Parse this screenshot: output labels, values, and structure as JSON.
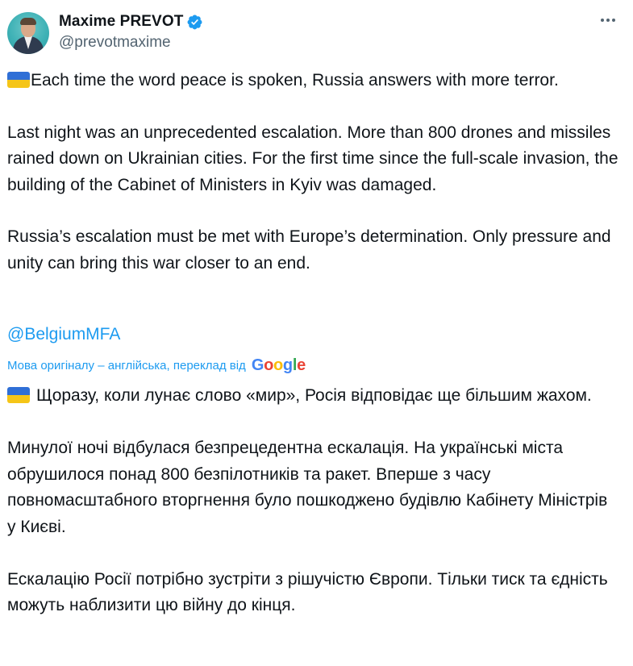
{
  "author": {
    "display_name": "Maxime PREVOT",
    "handle": "@prevotmaxime",
    "avatar_icon": "person-avatar",
    "verified_icon": "verified-badge-icon"
  },
  "menu": {
    "more_icon": "more-horizontal-icon"
  },
  "tweet": {
    "paragraphs": [
      "Each time the word peace is spoken, Russia answers with more terror.",
      "Last night was an unprecedented escalation. More than 800 drones and missiles rained down on Ukrainian cities. For the first time since the full-scale invasion, the building of the Cabinet of Ministers in Kyiv was damaged.",
      "Russia’s escalation must be met with Europe’s determination. Only pressure and unity can bring this war closer to an end."
    ],
    "mention": "@BelgiumMFA"
  },
  "translation": {
    "note": "Мова оригіналу – англійська, переклад від",
    "provider": "Google",
    "paragraphs": [
      "Щоразу, коли лунає слово «мир», Росія відповідає ще більшим жахом.",
      "Минулої ночі відбулася безпрецедентна ескалація. На українські міста обрушилося понад 800 безпілотників та ракет. Вперше з часу повномасштабного вторгнення було пошкоджено будівлю Кабінету Міністрів у Києві.",
      "Ескалацію Росії потрібно зустріти з рішучістю Європи. Тільки тиск та єдність можуть наблизити цю війну до кінця."
    ]
  },
  "colors": {
    "text": "#0f1419",
    "secondary": "#536471",
    "link": "#1d9bf0",
    "verified": "#1d9bf0",
    "flag_blue": "#2f6fd6",
    "flag_yellow": "#f5c518"
  }
}
